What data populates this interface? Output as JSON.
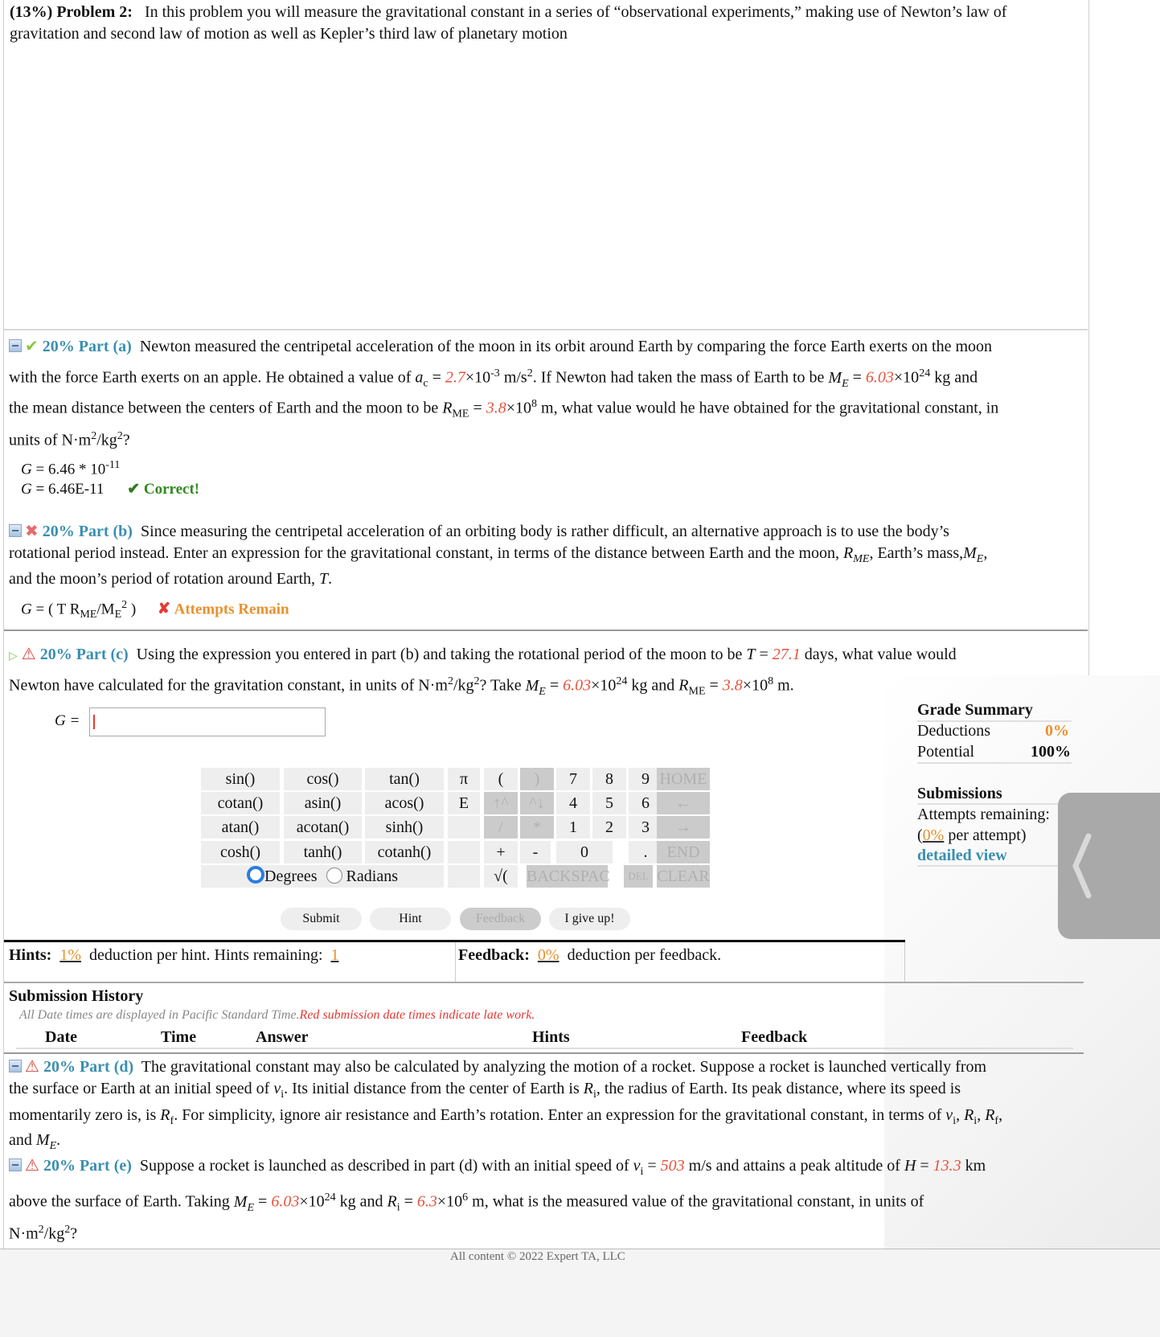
{
  "problem": {
    "label": "(13%) Problem 2:",
    "text": "In this problem you will measure the gravitational constant in a series of “observational experiments,” making use of Newton’s law of gravitation and second law of motion as well as Kepler’s third law of planetary motion"
  },
  "part_a": {
    "title": "20% Part (a)",
    "text1": "Newton measured the centripetal acceleration of the moon in its orbit around Earth by comparing the force Earth exerts on the moon",
    "text2a": "with the force Earth exerts on an apple. He obtained a value of ",
    "ac_value": "2.7",
    "ac_exp": "-3",
    "text2b": " m/s",
    "text2c": ". If Newton had taken the mass of Earth to be ",
    "me_value": "6.03",
    "me_exp": "24",
    "text2d": " kg and",
    "text3a": "the mean distance between the centers of Earth and the moon to be ",
    "rme_value": "3.8",
    "rme_exp": "8",
    "text3b": " m, what value would he have obtained for the gravitational constant, in",
    "text4": "units of N·m",
    "answer1": "= 6.46 * 10",
    "answer1_exp": "-11",
    "answer2": "= 6.46E-11",
    "status": "Correct!"
  },
  "part_b": {
    "title": "20% Part (b)",
    "text1": "Since measuring the centripetal acceleration of an orbiting body is rather difficult, an alternative approach is to use the body’s",
    "text2a": "rotational period instead. Enter an expression for the gravitational constant, in terms of the distance between Earth and the moon, ",
    "text2b": ", Earth’s mass,",
    "text3": "and the moon’s period of rotation around Earth, ",
    "answer_a": "= ( T R",
    "answer_b": "/M",
    "answer_c": " )",
    "status": "Attempts Remain"
  },
  "part_c": {
    "title": "20% Part (c)",
    "text1a": "Using the expression you entered in part (b) and taking the rotational period of the moon to be ",
    "t_value": "27.1",
    "text1b": " days, what value would",
    "text2a": "Newton have calculated for the gravitation constant, in units of N·m",
    "text2b": "? Take ",
    "me_value": "6.03",
    "me_exp": "24",
    "text2c": " kg and ",
    "rme_value": "3.8",
    "rme_exp": "8",
    "text2d": " m.",
    "input_label": "G =",
    "input_value": ""
  },
  "keypad": {
    "functions": [
      [
        "sin()",
        "cos()",
        "tan()"
      ],
      [
        "cotan()",
        "asin()",
        "acos()"
      ],
      [
        "atan()",
        "acotan()",
        "sinh()"
      ],
      [
        "cosh()",
        "tanh()",
        "cotanh()"
      ]
    ],
    "degrees_label": "Degrees",
    "radians_label": "Radians",
    "angle_mode": "Degrees",
    "pi": "π",
    "e": "E",
    "open_paren": "(",
    "close_paren": ")",
    "up": "↑^",
    "down": "^↓",
    "divide": "/",
    "multiply": "*",
    "plus": "+",
    "minus": "-",
    "sqrt": "√(",
    "digits": [
      "7",
      "8",
      "9",
      "4",
      "5",
      "6",
      "1",
      "2",
      "3",
      "0",
      "."
    ],
    "home": "HOME",
    "left": "←",
    "right": "→",
    "end": "END",
    "backspace": "BACKSPAC",
    "del": "DEL",
    "clear": "CLEAR"
  },
  "buttons": {
    "submit": "Submit",
    "hint": "Hint",
    "feedback": "Feedback",
    "give_up": "I give up!"
  },
  "hints": {
    "label": "Hints:",
    "deduction": "1%",
    "text": "deduction per hint. Hints remaining:",
    "remaining": "1"
  },
  "feedback": {
    "label": "Feedback:",
    "deduction": "0%",
    "text": "deduction per feedback."
  },
  "grade_summary": {
    "title": "Grade Summary",
    "deductions_label": "Deductions",
    "deductions_value": "0%",
    "potential_label": "Potential",
    "potential_value": "100%"
  },
  "submissions": {
    "title": "Submissions",
    "attempts_label": "Attempts remaining:",
    "attempts_value": "",
    "per_attempt_value": "0%",
    "per_attempt_text": " per attempt)",
    "detailed_view": "detailed view"
  },
  "history": {
    "title": "Submission History",
    "note": "All Date times are displayed in Pacific Standard Time.",
    "late_note": "Red submission date times indicate late work.",
    "columns": [
      "Date",
      "Time",
      "Answer",
      "Hints",
      "Feedback"
    ]
  },
  "part_d": {
    "title": "20% Part (d)",
    "text1": "The gravitational constant may also be calculated by analyzing the motion of a rocket. Suppose a rocket is launched vertically from",
    "text2a": "the surface or Earth at an initial speed of ",
    "text2b": ". Its initial distance from the center of Earth is ",
    "text2c": ", the radius of Earth. Its peak distance, where its speed is",
    "text3a": "momentarily zero is, is ",
    "text3b": ". For simplicity, ignore air resistance and Earth’s rotation. Enter an expression for the gravitational constant, in terms of ",
    "text4": "and "
  },
  "part_e": {
    "title": "20% Part (e)",
    "text1a": "Suppose a rocket is launched as described in part (d) with an initial speed of ",
    "vi_value": "503",
    "text1b": " m/s and attains a peak altitude of ",
    "h_value": "13.3",
    "text1c": " km",
    "text2a": "above the surface of Earth. Taking ",
    "me_value": "6.03",
    "me_exp": "24",
    "text2b": " kg and ",
    "ri_value": "6.3",
    "ri_exp": "6",
    "text2c": " m, what is the measured value of the gravitational constant, in units of",
    "text3": "N·m"
  },
  "footer": {
    "text": "All content © 2022 Expert TA, LLC"
  }
}
